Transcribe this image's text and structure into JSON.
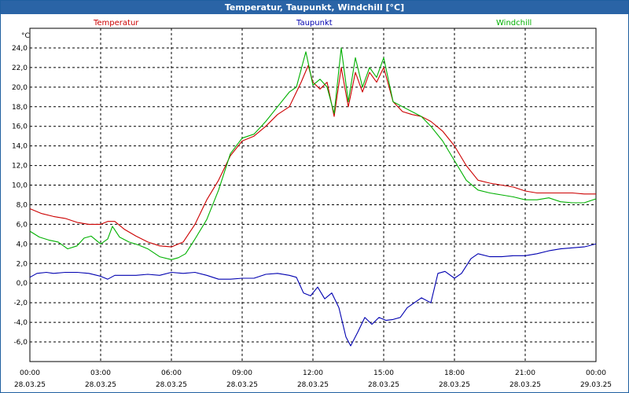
{
  "window": {
    "title": "Temperatur, Taupunkt, Windchill [°C]"
  },
  "chart_data": {
    "type": "line",
    "title": "Temperatur, Taupunkt, Windchill [°C]",
    "ylabel": "°C",
    "ylim": [
      -8,
      26
    ],
    "xlim": [
      0,
      24
    ],
    "yticks": [
      "24,0",
      "22,0",
      "20,0",
      "18,0",
      "16,0",
      "14,0",
      "12,0",
      "10,0",
      "8,0",
      "6,0",
      "4,0",
      "2,0",
      "0,0",
      "-2,0",
      "-4,0",
      "-6,0"
    ],
    "xticks": [
      {
        "time": "00:00",
        "date": "28.03.25"
      },
      {
        "time": "03:00",
        "date": "28.03.25"
      },
      {
        "time": "06:00",
        "date": "28.03.25"
      },
      {
        "time": "09:00",
        "date": "28.03.25"
      },
      {
        "time": "12:00",
        "date": "28.03.25"
      },
      {
        "time": "15:00",
        "date": "28.03.25"
      },
      {
        "time": "18:00",
        "date": "28.03.25"
      },
      {
        "time": "21:00",
        "date": "28.03.25"
      },
      {
        "time": "00:00",
        "date": "29.03.25"
      }
    ],
    "grid": true,
    "legend_position": "top",
    "series": [
      {
        "name": "Temperatur",
        "color": "#cc0000",
        "points": [
          [
            0,
            7.6
          ],
          [
            0.5,
            7.1
          ],
          [
            1,
            6.8
          ],
          [
            1.5,
            6.6
          ],
          [
            2,
            6.2
          ],
          [
            2.5,
            6.0
          ],
          [
            3,
            6.0
          ],
          [
            3.3,
            6.3
          ],
          [
            3.6,
            6.3
          ],
          [
            4,
            5.5
          ],
          [
            4.5,
            4.8
          ],
          [
            5,
            4.2
          ],
          [
            5.5,
            3.8
          ],
          [
            6,
            3.7
          ],
          [
            6.5,
            4.2
          ],
          [
            7,
            6.0
          ],
          [
            7.5,
            8.5
          ],
          [
            8,
            10.5
          ],
          [
            8.5,
            13.0
          ],
          [
            9,
            14.5
          ],
          [
            9.5,
            15.0
          ],
          [
            10,
            16.0
          ],
          [
            10.5,
            17.2
          ],
          [
            11,
            18.0
          ],
          [
            11.5,
            20.5
          ],
          [
            11.8,
            22.2
          ],
          [
            12,
            20.5
          ],
          [
            12.3,
            19.8
          ],
          [
            12.6,
            20.5
          ],
          [
            12.9,
            17.0
          ],
          [
            13.2,
            22.0
          ],
          [
            13.5,
            18.0
          ],
          [
            13.8,
            21.5
          ],
          [
            14.1,
            19.5
          ],
          [
            14.4,
            21.5
          ],
          [
            14.7,
            20.5
          ],
          [
            15,
            22.0
          ],
          [
            15.4,
            18.5
          ],
          [
            15.8,
            17.5
          ],
          [
            16.2,
            17.2
          ],
          [
            16.6,
            17.0
          ],
          [
            17,
            16.5
          ],
          [
            17.5,
            15.5
          ],
          [
            18,
            14.0
          ],
          [
            18.5,
            12.0
          ],
          [
            19,
            10.5
          ],
          [
            19.5,
            10.2
          ],
          [
            20,
            10.0
          ],
          [
            20.5,
            9.8
          ],
          [
            21,
            9.4
          ],
          [
            21.5,
            9.2
          ],
          [
            22,
            9.2
          ],
          [
            22.5,
            9.2
          ],
          [
            23,
            9.2
          ],
          [
            23.5,
            9.1
          ],
          [
            24,
            9.1
          ]
        ]
      },
      {
        "name": "Taupunkt",
        "color": "#0000b0",
        "points": [
          [
            0,
            0.6
          ],
          [
            0.3,
            1.0
          ],
          [
            0.7,
            1.1
          ],
          [
            1,
            1.0
          ],
          [
            1.5,
            1.1
          ],
          [
            2,
            1.1
          ],
          [
            2.5,
            1.0
          ],
          [
            3,
            0.7
          ],
          [
            3.3,
            0.4
          ],
          [
            3.6,
            0.8
          ],
          [
            4,
            0.8
          ],
          [
            4.5,
            0.8
          ],
          [
            5,
            0.9
          ],
          [
            5.5,
            0.8
          ],
          [
            6,
            1.1
          ],
          [
            6.5,
            1.0
          ],
          [
            7,
            1.1
          ],
          [
            7.5,
            0.8
          ],
          [
            8,
            0.4
          ],
          [
            8.5,
            0.4
          ],
          [
            9,
            0.5
          ],
          [
            9.5,
            0.5
          ],
          [
            10,
            0.9
          ],
          [
            10.5,
            1.0
          ],
          [
            11,
            0.8
          ],
          [
            11.3,
            0.6
          ],
          [
            11.6,
            -1.0
          ],
          [
            11.9,
            -1.3
          ],
          [
            12.2,
            -0.4
          ],
          [
            12.5,
            -1.6
          ],
          [
            12.8,
            -1.0
          ],
          [
            13.1,
            -2.5
          ],
          [
            13.4,
            -5.5
          ],
          [
            13.6,
            -6.4
          ],
          [
            13.9,
            -5.0
          ],
          [
            14.2,
            -3.5
          ],
          [
            14.5,
            -4.2
          ],
          [
            14.8,
            -3.5
          ],
          [
            15.1,
            -3.8
          ],
          [
            15.4,
            -3.7
          ],
          [
            15.7,
            -3.5
          ],
          [
            16,
            -2.5
          ],
          [
            16.3,
            -2.0
          ],
          [
            16.6,
            -1.5
          ],
          [
            17,
            -2.0
          ],
          [
            17.3,
            1.0
          ],
          [
            17.6,
            1.2
          ],
          [
            18,
            0.5
          ],
          [
            18.3,
            1.0
          ],
          [
            18.7,
            2.5
          ],
          [
            19,
            3.0
          ],
          [
            19.5,
            2.7
          ],
          [
            20,
            2.7
          ],
          [
            20.5,
            2.8
          ],
          [
            21,
            2.8
          ],
          [
            21.5,
            3.0
          ],
          [
            22,
            3.3
          ],
          [
            22.5,
            3.5
          ],
          [
            23,
            3.6
          ],
          [
            23.5,
            3.7
          ],
          [
            24,
            4.0
          ]
        ]
      },
      {
        "name": "Windchill",
        "color": "#00b000",
        "points": [
          [
            0,
            5.3
          ],
          [
            0.4,
            4.7
          ],
          [
            0.8,
            4.4
          ],
          [
            1.2,
            4.2
          ],
          [
            1.6,
            3.5
          ],
          [
            2,
            3.8
          ],
          [
            2.3,
            4.6
          ],
          [
            2.6,
            4.8
          ],
          [
            3,
            4.0
          ],
          [
            3.3,
            4.5
          ],
          [
            3.5,
            5.8
          ],
          [
            3.8,
            4.7
          ],
          [
            4.2,
            4.2
          ],
          [
            4.6,
            3.9
          ],
          [
            5,
            3.5
          ],
          [
            5.5,
            2.7
          ],
          [
            6,
            2.4
          ],
          [
            6.3,
            2.6
          ],
          [
            6.6,
            3.0
          ],
          [
            7,
            4.5
          ],
          [
            7.5,
            6.5
          ],
          [
            8,
            9.5
          ],
          [
            8.5,
            13.2
          ],
          [
            9,
            14.8
          ],
          [
            9.5,
            15.2
          ],
          [
            10,
            16.5
          ],
          [
            10.5,
            18.0
          ],
          [
            11,
            19.5
          ],
          [
            11.3,
            20.0
          ],
          [
            11.7,
            23.6
          ],
          [
            12,
            20.2
          ],
          [
            12.3,
            20.8
          ],
          [
            12.6,
            20.0
          ],
          [
            12.9,
            17.3
          ],
          [
            13.2,
            24.0
          ],
          [
            13.5,
            18.5
          ],
          [
            13.8,
            23.0
          ],
          [
            14.1,
            20.0
          ],
          [
            14.4,
            22.0
          ],
          [
            14.7,
            21.0
          ],
          [
            15,
            23.0
          ],
          [
            15.4,
            18.5
          ],
          [
            15.8,
            18.0
          ],
          [
            16.2,
            17.5
          ],
          [
            16.6,
            17.0
          ],
          [
            17,
            16.0
          ],
          [
            17.5,
            14.5
          ],
          [
            18,
            12.5
          ],
          [
            18.5,
            10.5
          ],
          [
            19,
            9.5
          ],
          [
            19.5,
            9.2
          ],
          [
            20,
            9.0
          ],
          [
            20.5,
            8.8
          ],
          [
            21,
            8.5
          ],
          [
            21.5,
            8.5
          ],
          [
            22,
            8.7
          ],
          [
            22.5,
            8.3
          ],
          [
            23,
            8.2
          ],
          [
            23.5,
            8.2
          ],
          [
            24,
            8.6
          ]
        ]
      }
    ]
  }
}
